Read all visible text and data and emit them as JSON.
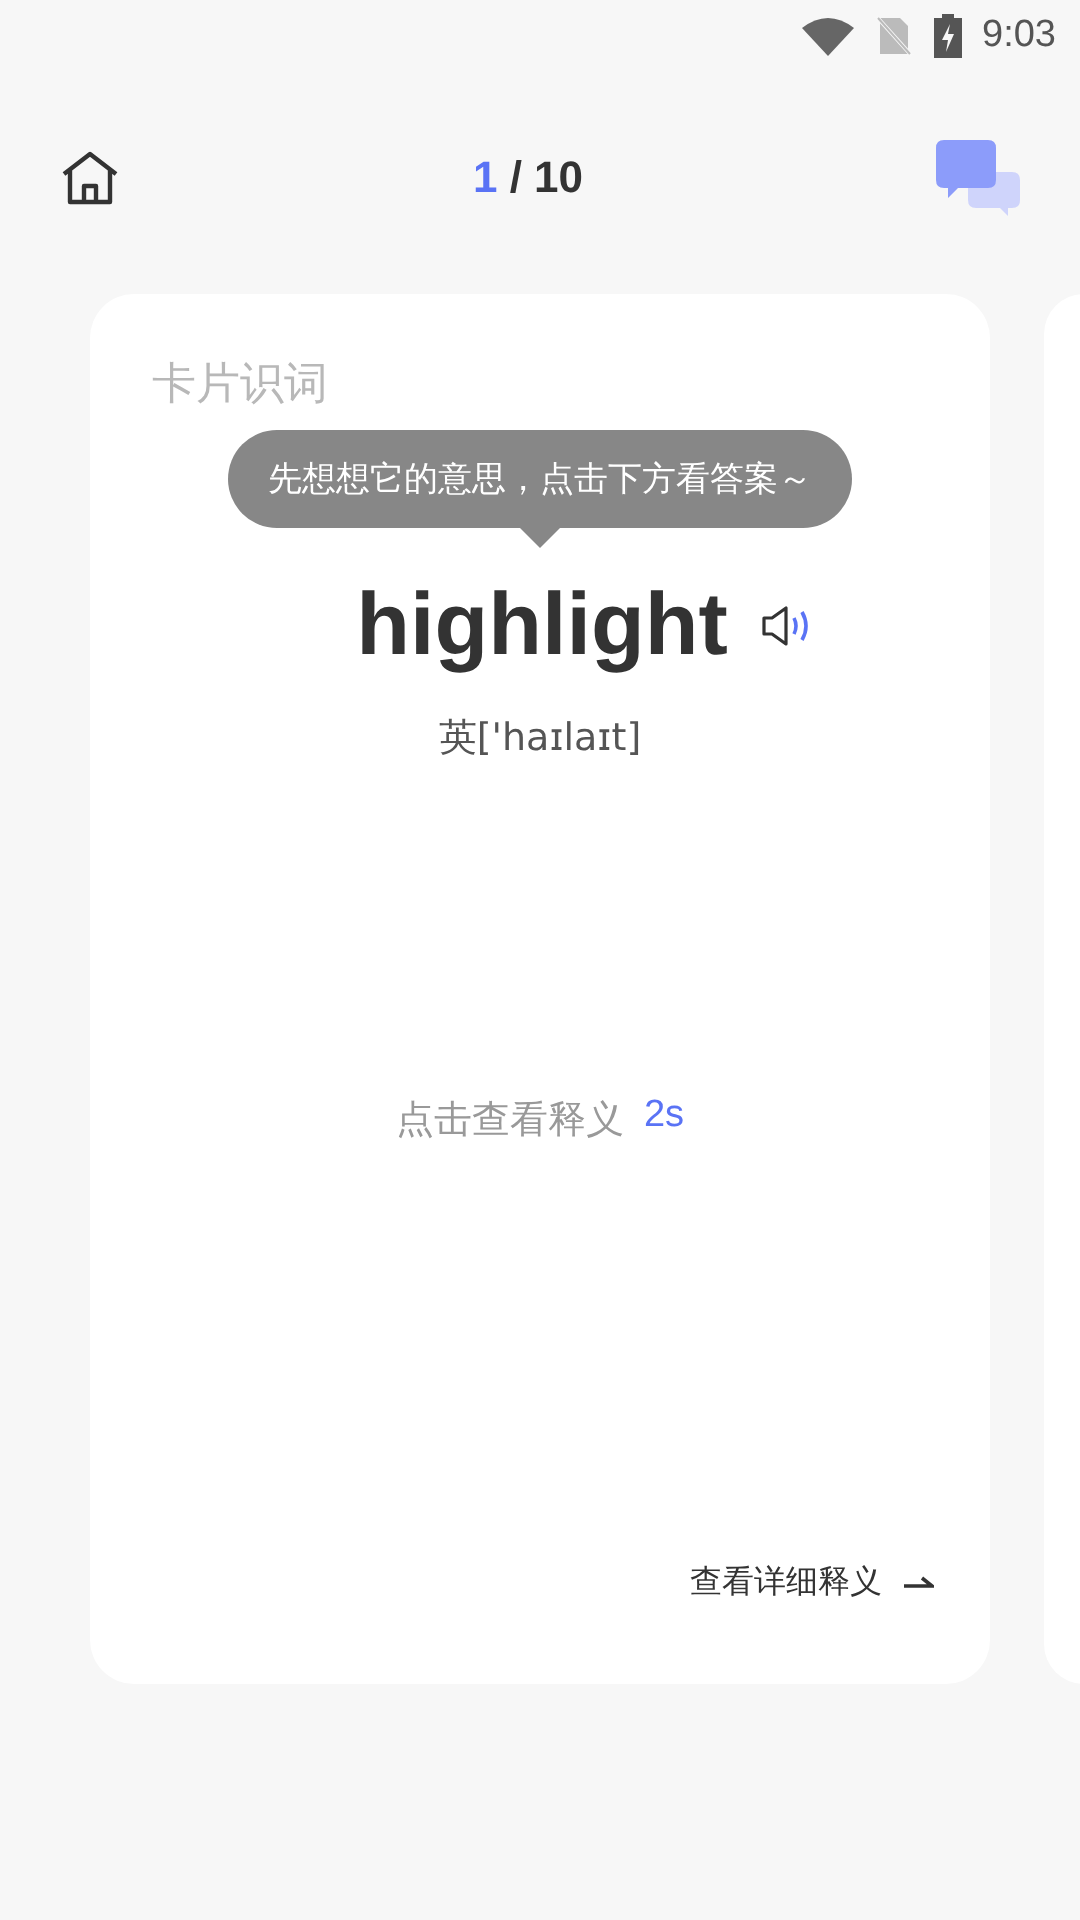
{
  "status_bar": {
    "time": "9:03"
  },
  "header": {
    "current": "1",
    "total": "/ 10"
  },
  "card": {
    "title": "卡片识词",
    "tooltip": "先想想它的意思，点击下方看答案～",
    "word": "highlight",
    "phonetic": "英['haɪlaɪt]",
    "reveal_label": "点击查看释义",
    "countdown": "2s",
    "detail_link": "查看详细释义"
  }
}
